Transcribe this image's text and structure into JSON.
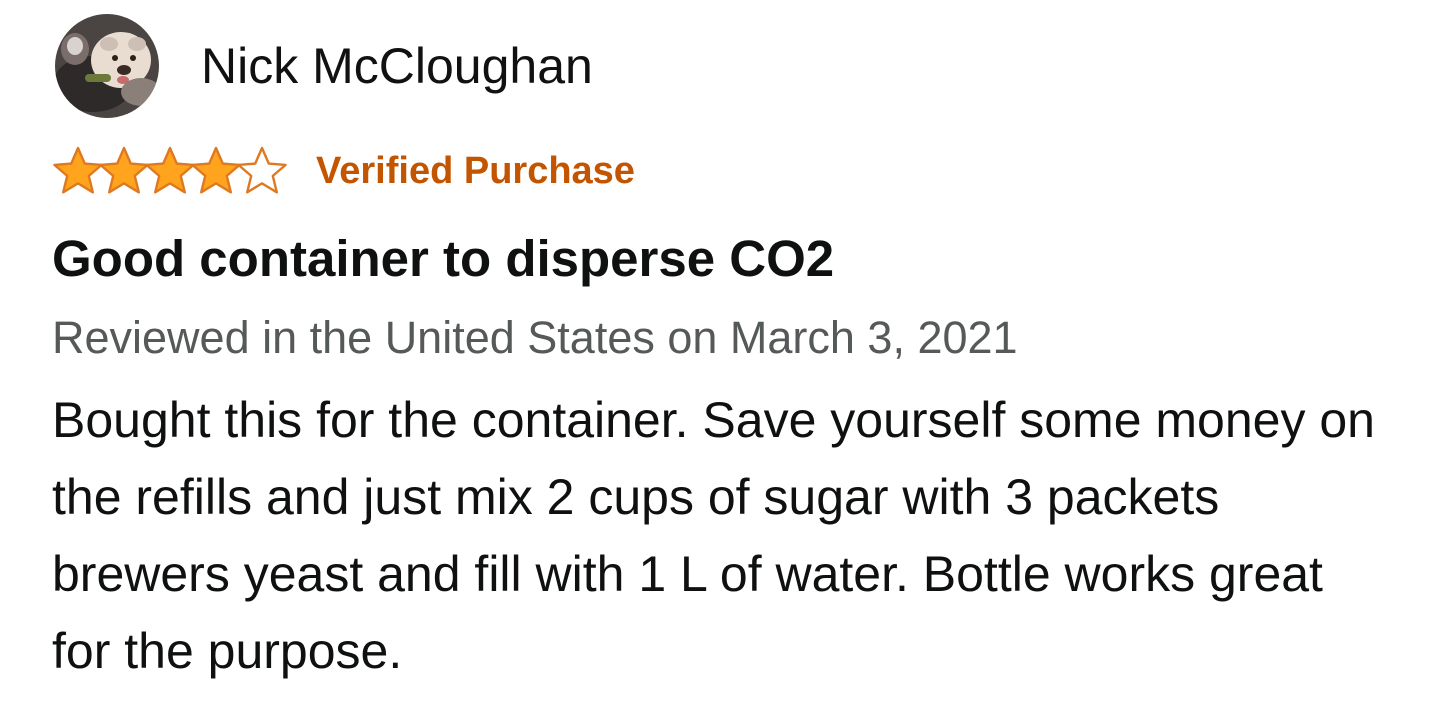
{
  "review": {
    "reviewer_name": "Nick McCloughan",
    "rating": 4,
    "rating_max": 5,
    "verified_label": "Verified Purchase",
    "title": "Good container to disperse CO2",
    "date_line": "Reviewed in the United States on March 3, 2021",
    "body": "Bought this for the container. Save yourself some money on the refills and just mix 2 cups of sugar with 3 packets brewers yeast and fill with 1 L of water. Bottle works great for the purpose."
  },
  "colors": {
    "star_fill": "#ffa41c",
    "star_outline": "#de7921",
    "verified": "#c45500",
    "date_text": "#565959",
    "body_text": "#0f1111"
  },
  "icons": {
    "avatar": "bulldog-photo",
    "star_filled": "star-filled-icon",
    "star_empty": "star-empty-icon"
  }
}
